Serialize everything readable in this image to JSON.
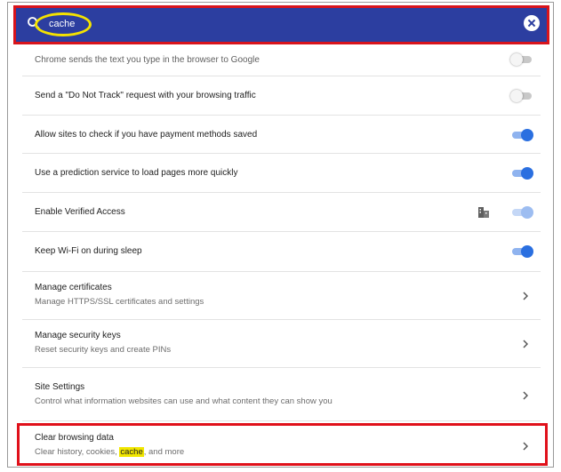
{
  "search": {
    "query": "cache"
  },
  "colors": {
    "search_bar": "#2c3ea0",
    "annotation_red": "#d8141c",
    "annotation_yellow": "#f4e200",
    "toggle_on": "#2a6fe0"
  },
  "rows": [
    {
      "label": "Chrome sends the text you type in the browser to Google",
      "control": "toggle",
      "state": "off"
    },
    {
      "label": "Send a \"Do Not Track\" request with your browsing traffic",
      "control": "toggle",
      "state": "off"
    },
    {
      "label": "Allow sites to check if you have payment methods saved",
      "control": "toggle",
      "state": "on"
    },
    {
      "label": "Use a prediction service to load pages more quickly",
      "control": "toggle",
      "state": "on"
    },
    {
      "label": "Enable Verified Access",
      "control": "toggle",
      "state": "on-disabled",
      "icon": "enterprise-policy-icon"
    },
    {
      "label": "Keep Wi-Fi on during sleep",
      "control": "toggle",
      "state": "on"
    },
    {
      "title": "Manage certificates",
      "subtitle": "Manage HTTPS/SSL certificates and settings",
      "control": "chevron"
    },
    {
      "title": "Manage security keys",
      "subtitle": "Reset security keys and create PINs",
      "control": "chevron"
    },
    {
      "title": "Site Settings",
      "subtitle": "Control what information websites can use and what content they can show you",
      "control": "chevron"
    },
    {
      "title": "Clear browsing data",
      "subtitle_before": "Clear history, cookies, ",
      "subtitle_match": "cache",
      "subtitle_after": ", and more",
      "control": "chevron"
    }
  ]
}
